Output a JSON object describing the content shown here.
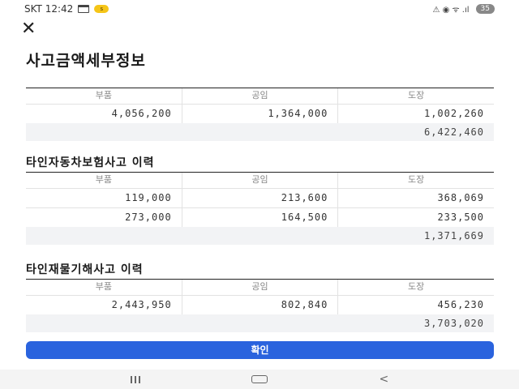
{
  "status_bar": {
    "carrier_time": "SKT 12:42",
    "kakao_badge": "s",
    "right_icons": "⚠ ◉ ᯤ .ıl",
    "battery": "35",
    "icons": [
      "calendar-icon",
      "kakao-icon",
      "mute-icon",
      "location-icon",
      "wifi-icon",
      "signal-icon",
      "battery-icon"
    ]
  },
  "page": {
    "title": "사고금액세부정보"
  },
  "table1": {
    "headers": [
      "부품",
      "공임",
      "도장"
    ],
    "rows": [
      [
        "4,056,200",
        "1,364,000",
        "1,002,260"
      ]
    ],
    "total": "6,422,460"
  },
  "section2": {
    "title": "타인자동차보험사고 이력"
  },
  "table2": {
    "headers": [
      "부품",
      "공임",
      "도장"
    ],
    "rows": [
      [
        "119,000",
        "213,600",
        "368,069"
      ],
      [
        "273,000",
        "164,500",
        "233,500"
      ]
    ],
    "total": "1,371,669"
  },
  "section3": {
    "title": "타인재물기해사고 이력"
  },
  "table3": {
    "headers": [
      "부품",
      "공임",
      "도장"
    ],
    "rows": [
      [
        "2,443,950",
        "802,840",
        "456,230"
      ]
    ],
    "total": "3,703,020"
  },
  "confirm_label": "확인",
  "colors": {
    "primary": "#2a63de",
    "total_bg": "#f2f3f5"
  }
}
